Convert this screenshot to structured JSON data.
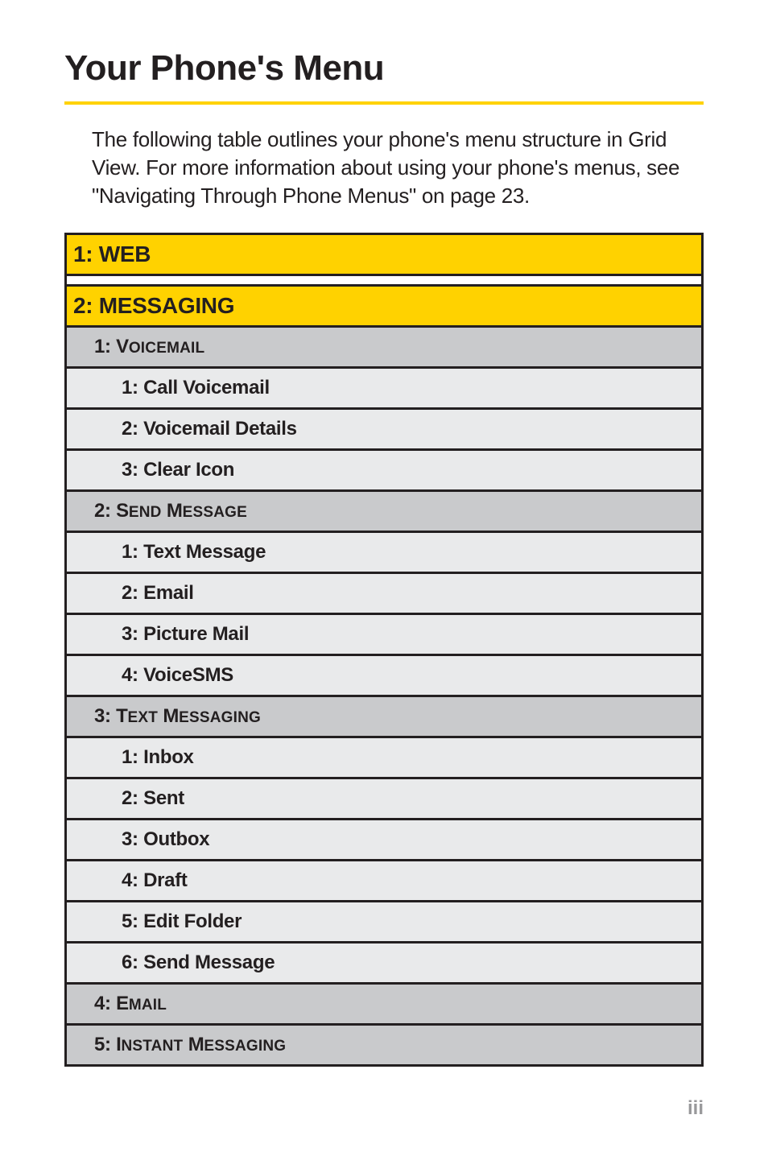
{
  "title": "Your Phone's Menu",
  "intro": "The following table outlines your phone's menu structure in Grid View. For more information about using your phone's menus, see \"Navigating Through Phone Menus\" on page 23.",
  "page_number": "iii",
  "menu": {
    "top": [
      {
        "label": "1: WEB"
      },
      {
        "label": "2: MESSAGING",
        "children": [
          {
            "label_prefix": "1: ",
            "label_first": "V",
            "label_rest": "oicemail",
            "children": [
              {
                "label": "1: Call Voicemail"
              },
              {
                "label": "2: Voicemail Details"
              },
              {
                "label": "3: Clear Icon"
              }
            ]
          },
          {
            "label_prefix": "2: ",
            "label_first": "S",
            "label_rest": "end",
            "label_first2": " M",
            "label_rest2": "essage",
            "children": [
              {
                "label": "1: Text Message"
              },
              {
                "label": "2: Email"
              },
              {
                "label": "3: Picture Mail"
              },
              {
                "label": "4: VoiceSMS"
              }
            ]
          },
          {
            "label_prefix": "3: ",
            "label_first": "T",
            "label_rest": "ext",
            "label_first2": " M",
            "label_rest2": "essaging",
            "children": [
              {
                "label": "1: Inbox"
              },
              {
                "label": "2: Sent"
              },
              {
                "label": "3: Outbox"
              },
              {
                "label": "4: Draft"
              },
              {
                "label": "5: Edit Folder"
              },
              {
                "label": "6: Send Message"
              }
            ]
          },
          {
            "label_prefix": "4: ",
            "label_first": "E",
            "label_rest": "mail"
          },
          {
            "label_prefix": "5: ",
            "label_first": "I",
            "label_rest": "nstant",
            "label_first2": " M",
            "label_rest2": "essaging"
          }
        ]
      }
    ]
  }
}
